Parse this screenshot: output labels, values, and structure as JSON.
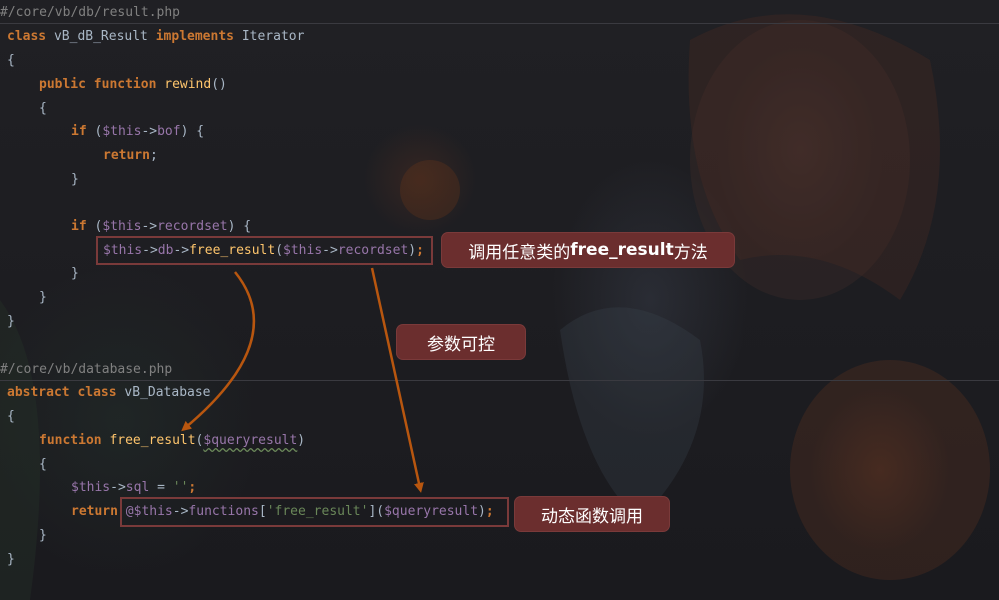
{
  "file1": {
    "path": "#/core/vb/db/result.php",
    "lines": {
      "class_kw": "class",
      "class_name": " vB_dB_Result ",
      "implements_kw": "implements",
      "iface": " Iterator",
      "open_brace": "{",
      "public_kw": "public",
      "function_kw": "function",
      "rewind": "rewind",
      "rewind_parens": "()",
      "brace_open_2": "{",
      "if_kw": "if",
      "if1_open": " (",
      "this_var": "$this",
      "arrow": "->",
      "bof": "bof",
      "if1_close": ") {",
      "return_kw": "return",
      "semicolon": ";",
      "brace_close_3": "}",
      "if2_open": " (",
      "recordset": "recordset",
      "if2_close": ") {",
      "db": "db",
      "free_result": "free_result",
      "paren_open": "(",
      "paren_close": ")",
      "brace_close_4": "}",
      "brace_close_5": "}",
      "brace_close_6": "}"
    }
  },
  "file2": {
    "path": "#/core/vb/database.php",
    "lines": {
      "abstract_kw": "abstract",
      "class_kw": "class",
      "class_name": " vB_Database",
      "open_brace": "{",
      "function_kw": "function",
      "free_result": "free_result",
      "paren_open": "(",
      "queryresult": "$queryresult",
      "paren_close": ")",
      "brace_open_2": "{",
      "this_var": "$this",
      "arrow": "->",
      "sql": "sql",
      "assign": " = ",
      "empty_str": "''",
      "semicolon": ";",
      "return_kw": "return",
      "at_this": "@$this",
      "functions": "functions",
      "bracket_open": "[",
      "str_free_result": "'free_result'",
      "bracket_close": "]",
      "brace_close_3": "}",
      "brace_close_4": "}"
    }
  },
  "annotations": {
    "call_any": {
      "prefix": "调用任意类的",
      "bold": "free_result",
      "suffix": "方法"
    },
    "param_control": "参数可控",
    "dynamic_call": "动态函数调用"
  },
  "colors": {
    "keyword": "#cc7832",
    "function": "#ffc66d",
    "variable": "#9876aa",
    "string": "#6a8759",
    "text": "#a9b7c6",
    "comment": "#808080",
    "label_bg": "#6b2e2e",
    "arrow": "#b8560f"
  }
}
